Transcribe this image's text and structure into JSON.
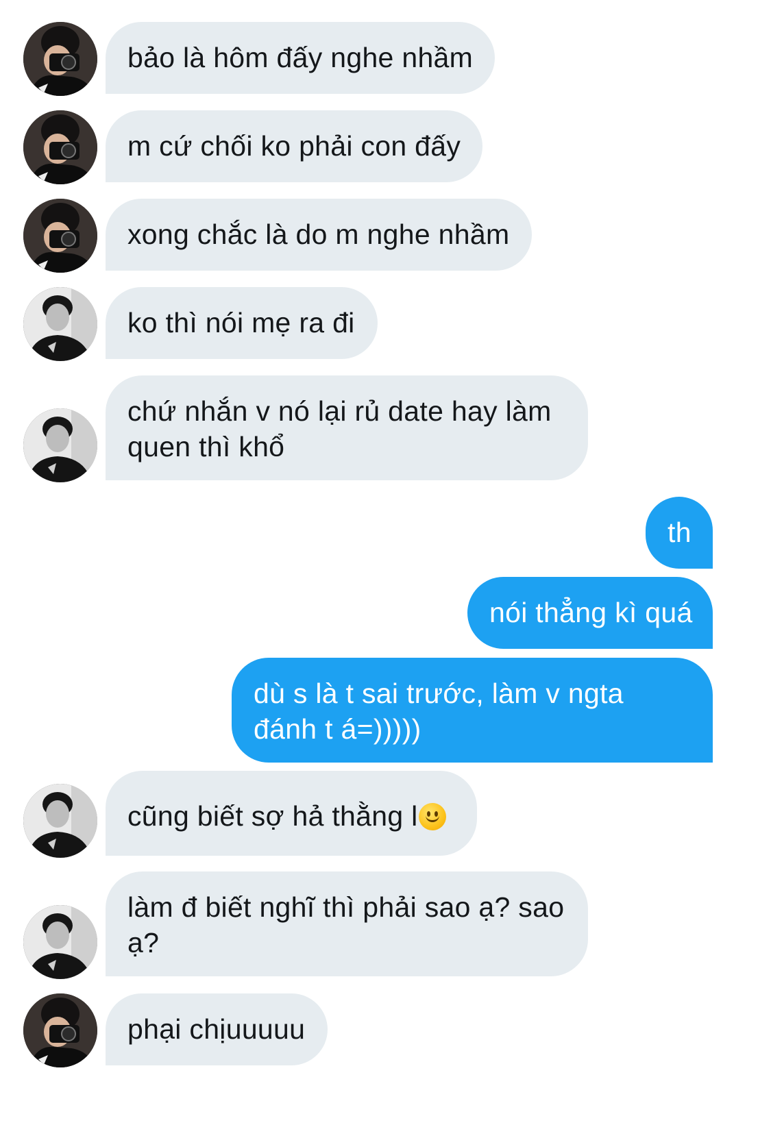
{
  "conversation": {
    "messages": [
      {
        "sender": "contact_a",
        "text": "bảo là hôm đấy nghe nhầm"
      },
      {
        "sender": "contact_a",
        "text": "m cứ chối ko phải con đấy"
      },
      {
        "sender": "contact_a",
        "text": "xong chắc là do m nghe nhầm"
      },
      {
        "sender": "contact_b",
        "text": "ko thì nói mẹ ra đi"
      },
      {
        "sender": "contact_b",
        "lines": [
          "chứ nhắn v nó lại rủ date hay làm",
          "quen thì khổ"
        ]
      },
      {
        "sender": "me",
        "text": "th"
      },
      {
        "sender": "me",
        "text": "nói thẳng kì quá"
      },
      {
        "sender": "me",
        "lines": [
          "dù s là t sai trước, làm v ngta",
          "đánh t á=)))))"
        ]
      },
      {
        "sender": "contact_b",
        "text": "cũng biết sợ hả thằng l",
        "emoji": "slightly-smiling-face"
      },
      {
        "sender": "contact_b",
        "lines": [
          "làm đ biết nghĩ thì phải sao ạ? sao",
          "ạ?"
        ]
      },
      {
        "sender": "contact_a",
        "text": "phại chịuuuuu"
      }
    ]
  },
  "colors": {
    "incoming_bubble": "#e6ecf0",
    "outgoing_bubble": "#1da1f2",
    "incoming_text": "#14171a",
    "outgoing_text": "#ffffff"
  }
}
